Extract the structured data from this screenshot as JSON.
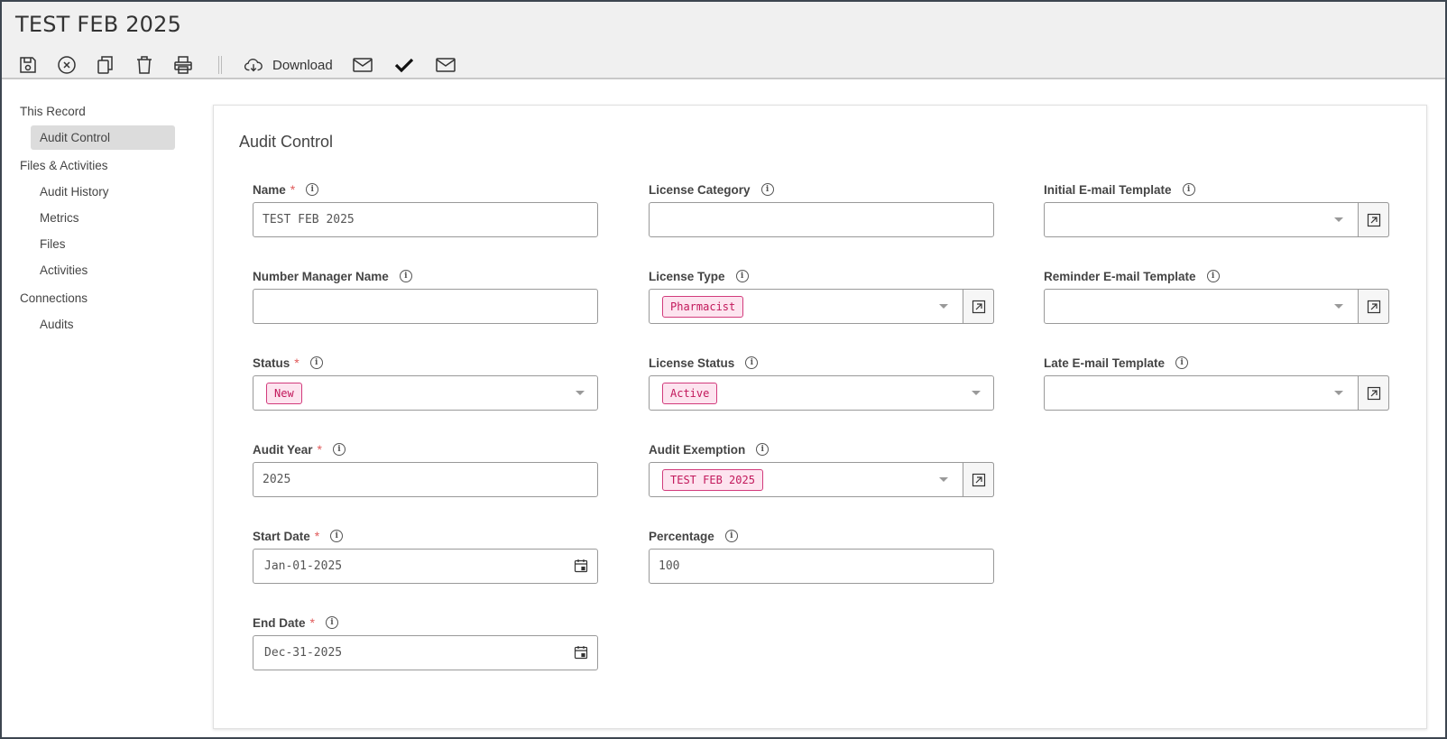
{
  "header": {
    "title": "TEST FEB 2025"
  },
  "toolbar": {
    "save": "save-icon",
    "cancel": "close-circle-icon",
    "copy": "copy-icon",
    "delete": "trash-icon",
    "print": "print-icon",
    "download_label": "Download",
    "email1": "mail-icon",
    "approve": "check-icon",
    "email2": "mail-icon"
  },
  "sidebar": {
    "groups": [
      {
        "label": "This Record",
        "items": [
          {
            "label": "Audit Control",
            "active": true
          }
        ]
      },
      {
        "label": "Files & Activities",
        "items": [
          {
            "label": "Audit History"
          },
          {
            "label": "Metrics"
          },
          {
            "label": "Files"
          },
          {
            "label": "Activities"
          }
        ]
      },
      {
        "label": "Connections",
        "items": [
          {
            "label": "Audits"
          }
        ]
      }
    ]
  },
  "panel": {
    "title": "Audit Control",
    "fields": {
      "name": {
        "label": "Name",
        "value": "TEST FEB 2025"
      },
      "number_manager": {
        "label": "Number Manager Name",
        "value": ""
      },
      "status": {
        "label": "Status",
        "value": "New"
      },
      "audit_year": {
        "label": "Audit Year",
        "value": "2025"
      },
      "start_date": {
        "label": "Start Date",
        "value": "Jan-01-2025"
      },
      "end_date": {
        "label": "End Date",
        "value": "Dec-31-2025"
      },
      "license_category": {
        "label": "License Category",
        "value": ""
      },
      "license_type": {
        "label": "License Type",
        "value": "Pharmacist"
      },
      "license_status": {
        "label": "License Status",
        "value": "Active"
      },
      "audit_exemption": {
        "label": "Audit Exemption",
        "value": "TEST FEB 2025"
      },
      "percentage": {
        "label": "Percentage",
        "value": "100"
      },
      "initial_template": {
        "label": "Initial E-mail Template",
        "value": ""
      },
      "reminder_template": {
        "label": "Reminder E-mail Template",
        "value": ""
      },
      "late_template": {
        "label": "Late E-mail Template",
        "value": ""
      }
    }
  },
  "colors": {
    "tag_bg": "#fde4ef",
    "tag_border": "#d23b7c",
    "required": "#e05a5a",
    "header_bg": "#f0f0f0"
  }
}
